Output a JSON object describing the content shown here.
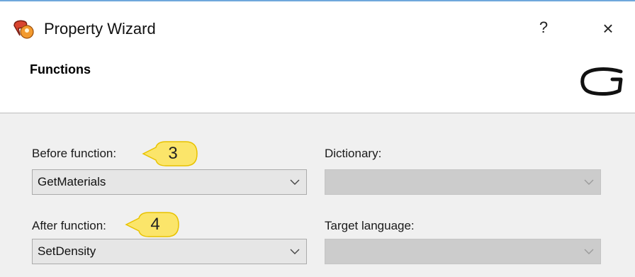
{
  "window": {
    "title": "Property Wizard",
    "help_label": "?",
    "close_label": "×"
  },
  "header": {
    "section_title": "Functions"
  },
  "form": {
    "before_function": {
      "label": "Before function:",
      "value": "GetMaterials"
    },
    "after_function": {
      "label": "After function:",
      "value": "SetDensity"
    },
    "dictionary": {
      "label": "Dictionary:",
      "value": ""
    },
    "target_language": {
      "label": "Target language:",
      "value": ""
    }
  },
  "callouts": [
    {
      "number": "3"
    },
    {
      "number": "4"
    }
  ],
  "colors": {
    "callout_fill": "#fbe56a",
    "callout_stroke": "#e8c200",
    "content_bg": "#f0f0f0",
    "accent_line": "#6fa8dc",
    "app_icon_red": "#d9442f",
    "app_icon_orange": "#f29a2e"
  },
  "icons": {
    "app": "property-wizard-app-icon",
    "logo": "brand-logo",
    "dropdown": "chevron-down-icon"
  }
}
